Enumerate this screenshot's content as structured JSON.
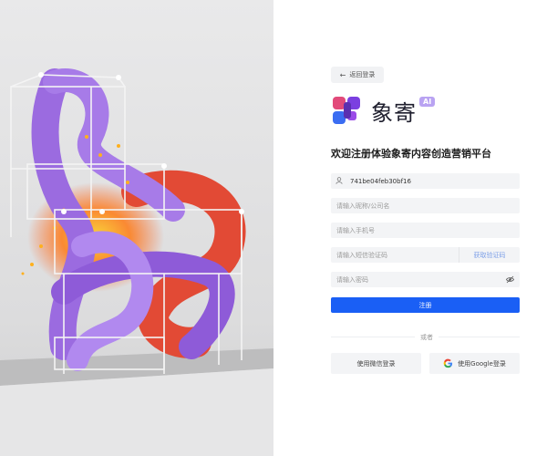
{
  "back": {
    "arrow": "←",
    "label": "返回登录"
  },
  "brand": {
    "name": "象寄",
    "badge": "AI"
  },
  "headline": "欢迎注册体验象寄内容创造营销平台",
  "form": {
    "invite_code": "741be04feb30bf16",
    "name_placeholder": "请输入昵称/公司名",
    "phone_placeholder": "请输入手机号",
    "sms_placeholder": "请输入短信验证码",
    "sms_button": "获取验证码",
    "password_placeholder": "请输入密码",
    "register_button": "注册"
  },
  "divider_text": "或者",
  "social": {
    "wechat_label": "使用微信登录",
    "google_label": "使用Google登录"
  },
  "colors": {
    "primary": "#1a5ff5",
    "sms_link": "#7ea0e8",
    "badge": "#b9a3f2",
    "field_bg": "#f3f4f6"
  },
  "icons": [
    "arrow-left-icon",
    "brand-logo-icon",
    "user-icon",
    "eye-off-icon",
    "google-icon"
  ]
}
